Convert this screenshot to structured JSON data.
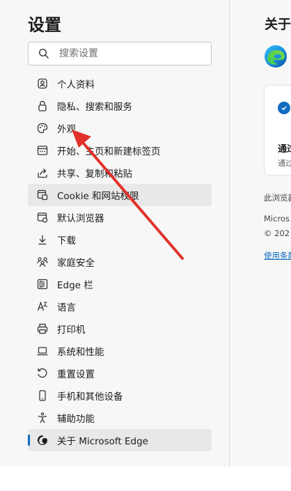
{
  "sidebar": {
    "title": "设置",
    "search_placeholder": "搜索设置",
    "items": [
      {
        "label": "个人资料",
        "icon": "profile-icon"
      },
      {
        "label": "隐私、搜索和服务",
        "icon": "lock-icon"
      },
      {
        "label": "外观",
        "icon": "palette-icon"
      },
      {
        "label": "开始、主页和新建标签页",
        "icon": "start-page-icon"
      },
      {
        "label": "共享、复制和粘贴",
        "icon": "share-icon"
      },
      {
        "label": "Cookie 和网站权限",
        "icon": "cookie-permissions-icon"
      },
      {
        "label": "默认浏览器",
        "icon": "default-browser-icon"
      },
      {
        "label": "下载",
        "icon": "download-icon"
      },
      {
        "label": "家庭安全",
        "icon": "family-icon"
      },
      {
        "label": "Edge 栏",
        "icon": "edge-bar-icon"
      },
      {
        "label": "语言",
        "icon": "language-icon"
      },
      {
        "label": "打印机",
        "icon": "printer-icon"
      },
      {
        "label": "系统和性能",
        "icon": "laptop-icon"
      },
      {
        "label": "重置设置",
        "icon": "reset-icon"
      },
      {
        "label": "手机和其他设备",
        "icon": "phone-icon"
      },
      {
        "label": "辅助功能",
        "icon": "accessibility-icon"
      },
      {
        "label": "关于 Microsoft Edge",
        "icon": "edge-logo-icon"
      }
    ],
    "hover_item_index": 5,
    "selected_item_index": 16
  },
  "about_panel": {
    "title": "关于",
    "card_title": "通过",
    "card_subtitle": "通过",
    "note": "此浏览器",
    "company": "Micros",
    "copyright": "© 202",
    "terms_link": "使用条款"
  },
  "colors": {
    "accent": "#0f6cbd",
    "annotation_arrow": "#e0322b",
    "background": "#f7f7f7"
  }
}
